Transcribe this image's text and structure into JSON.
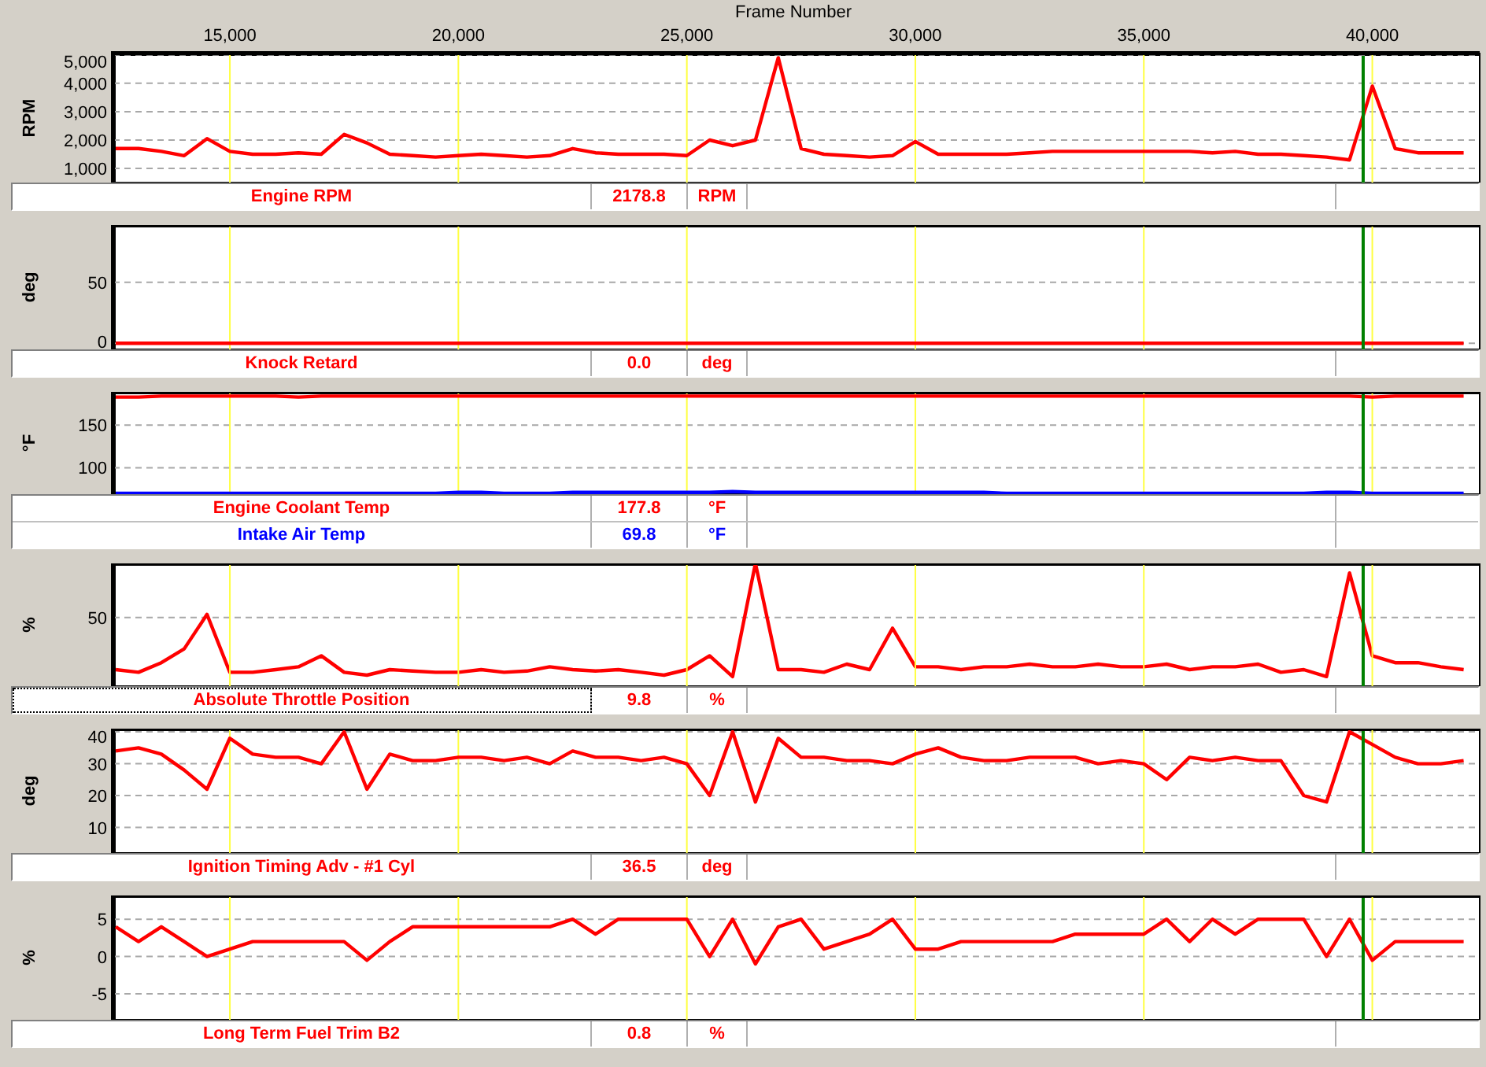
{
  "panels": [
    {
      "chart_data": {
        "type": "line",
        "xlabel": "Frame Number",
        "ylabel": "RPM",
        "xlim": [
          12450,
          42350
        ],
        "ylim": [
          500,
          5050
        ],
        "grid": true,
        "xticks": [
          {
            "value": 15000,
            "label": "15,000"
          },
          {
            "value": 20000,
            "label": "20,000"
          },
          {
            "value": 25000,
            "label": "25,000"
          },
          {
            "value": 30000,
            "label": "30,000"
          },
          {
            "value": 35000,
            "label": "35,000"
          },
          {
            "value": 40000,
            "label": "40,000"
          }
        ],
        "yticks": [
          {
            "value": 1000,
            "label": "1,000"
          },
          {
            "value": 2000,
            "label": "2,000"
          },
          {
            "value": 3000,
            "label": "3,000"
          },
          {
            "value": 4000,
            "label": "4,000"
          },
          {
            "value": 5000,
            "label": "5,000"
          }
        ],
        "x": [
          12500,
          13000,
          13500,
          14000,
          14500,
          15000,
          15500,
          16000,
          16500,
          17000,
          17500,
          18000,
          18500,
          19000,
          19500,
          20000,
          20500,
          21000,
          21500,
          22000,
          22500,
          23000,
          23500,
          24000,
          24500,
          25000,
          25500,
          26000,
          26500,
          27000,
          27500,
          28000,
          28500,
          29000,
          29500,
          30000,
          30500,
          31000,
          31500,
          32000,
          32500,
          33000,
          33500,
          34000,
          34500,
          35000,
          35500,
          36000,
          36500,
          37000,
          37500,
          38000,
          38500,
          39000,
          39500,
          40000,
          40500,
          41000,
          41500,
          42000
        ],
        "series": [
          {
            "name": "Engine RPM",
            "color": "#ff0000",
            "values": [
              1700,
              1700,
              1600,
              1450,
              2050,
              1600,
              1500,
              1500,
              1550,
              1500,
              2200,
              1900,
              1500,
              1450,
              1400,
              1450,
              1500,
              1450,
              1400,
              1450,
              1700,
              1550,
              1500,
              1500,
              1500,
              1450,
              2000,
              1800,
              2000,
              4900,
              1700,
              1500,
              1450,
              1400,
              1450,
              1950,
              1500,
              1500,
              1500,
              1500,
              1550,
              1600,
              1600,
              1600,
              1600,
              1600,
              1600,
              1600,
              1550,
              1600,
              1500,
              1500,
              1450,
              1400,
              1300,
              3900,
              1700,
              1550,
              1550,
              1550
            ]
          }
        ],
        "ref_lines": [
          {
            "axis": "x",
            "value": 39800,
            "color": "#008000"
          }
        ]
      },
      "legend": [
        {
          "value": "2178.8",
          "unit": "RPM",
          "selected": false
        }
      ]
    },
    {
      "chart_data": {
        "type": "line",
        "ylabel": "deg",
        "xlim": [
          12450,
          42350
        ],
        "ylim": [
          -5,
          97
        ],
        "grid": true,
        "yticks": [
          {
            "value": 0,
            "label": "0"
          },
          {
            "value": 50,
            "label": "50"
          }
        ],
        "x": [
          12500,
          13000,
          13500,
          14000,
          14500,
          15000,
          15500,
          16000,
          16500,
          17000,
          17500,
          18000,
          18500,
          19000,
          19500,
          20000,
          20500,
          21000,
          21500,
          22000,
          22500,
          23000,
          23500,
          24000,
          24500,
          25000,
          25500,
          26000,
          26500,
          27000,
          27500,
          28000,
          28500,
          29000,
          29500,
          30000,
          30500,
          31000,
          31500,
          32000,
          32500,
          33000,
          33500,
          34000,
          34500,
          35000,
          35500,
          36000,
          36500,
          37000,
          37500,
          38000,
          38500,
          39000,
          39500,
          40000,
          40500,
          41000,
          41500,
          42000
        ],
        "series": [
          {
            "name": "Knock Retard",
            "color": "#ff0000",
            "values": [
              0,
              0,
              0,
              0,
              0,
              0,
              0,
              0,
              0,
              0,
              0,
              0,
              0,
              0,
              0,
              0,
              0,
              0,
              0,
              0,
              0,
              0,
              0,
              0,
              0,
              0,
              0,
              0,
              0,
              0,
              0,
              0,
              0,
              0,
              0,
              0,
              0,
              0,
              0,
              0,
              0,
              0,
              0,
              0,
              0,
              0,
              0,
              0,
              0,
              0,
              0,
              0,
              0,
              0,
              0,
              0,
              0,
              0,
              0,
              0
            ]
          }
        ],
        "ref_lines": [
          {
            "axis": "x",
            "value": 39800,
            "color": "#008000"
          }
        ]
      },
      "legend": [
        {
          "value": "0.0",
          "unit": "deg",
          "selected": false
        }
      ]
    },
    {
      "chart_data": {
        "type": "line",
        "ylabel": "°F",
        "xlim": [
          12450,
          42350
        ],
        "ylim": [
          69,
          189
        ],
        "grid": true,
        "yticks": [
          {
            "value": 100,
            "label": "100"
          },
          {
            "value": 150,
            "label": "150"
          }
        ],
        "x": [
          12500,
          13000,
          13500,
          14000,
          14500,
          15000,
          15500,
          16000,
          16500,
          17000,
          17500,
          18000,
          18500,
          19000,
          19500,
          20000,
          20500,
          21000,
          21500,
          22000,
          22500,
          23000,
          23500,
          24000,
          24500,
          25000,
          25500,
          26000,
          26500,
          27000,
          27500,
          28000,
          28500,
          29000,
          29500,
          30000,
          30500,
          31000,
          31500,
          32000,
          32500,
          33000,
          33500,
          34000,
          34500,
          35000,
          35500,
          36000,
          36500,
          37000,
          37500,
          38000,
          38500,
          39000,
          39500,
          40000,
          40500,
          41000,
          41500,
          42000
        ],
        "series": [
          {
            "name": "Engine Coolant Temp",
            "color": "#ff0000",
            "values": [
              183,
              183,
              184,
              184,
              184,
              184,
              184,
              184,
              183,
              184,
              184,
              184,
              184,
              184,
              184,
              184,
              184,
              184,
              184,
              184,
              184,
              184,
              184,
              184,
              184,
              184,
              184,
              184,
              184,
              184,
              184,
              184,
              184,
              184,
              184,
              184,
              184,
              184,
              184,
              184,
              184,
              184,
              184,
              184,
              184,
              184,
              184,
              184,
              184,
              184,
              184,
              184,
              184,
              184,
              184,
              183,
              184,
              184,
              184,
              184
            ]
          },
          {
            "name": "Intake Air Temp",
            "color": "#0000ff",
            "values": [
              70,
              70,
              70,
              70,
              70,
              70,
              70,
              70,
              70,
              70,
              70,
              70,
              70,
              70,
              70,
              71,
              71,
              70,
              70,
              70,
              71,
              71,
              71,
              71,
              71,
              71,
              71,
              72,
              71,
              71,
              71,
              71,
              71,
              71,
              71,
              71,
              71,
              71,
              71,
              70,
              70,
              70,
              70,
              70,
              70,
              70,
              70,
              70,
              70,
              70,
              70,
              70,
              70,
              71,
              71,
              70,
              70,
              70,
              70,
              70
            ]
          }
        ],
        "ref_lines": [
          {
            "axis": "x",
            "value": 39800,
            "color": "#008000"
          }
        ]
      },
      "legend": [
        {
          "value": "177.8",
          "unit": "°F",
          "selected": false
        },
        {
          "value": "69.8",
          "unit": "°F",
          "selected": false
        }
      ]
    },
    {
      "plot": {
        "ylabel": "%",
        "tick_labels": [
          "50"
        ]
      },
      "legend": [
        {
          "name": "Absolute Throttle Position",
          "color": "#ff0000",
          "value": "9.8",
          "unit": "%",
          "selected": true
        }
      ]
    },
    {
      "chart_data": {
        "type": "line",
        "ylabel": "deg",
        "xlim": [
          12450,
          42350
        ],
        "ylim": [
          2,
          41
        ],
        "grid": true,
        "yticks": [
          {
            "value": 10,
            "label": "10"
          },
          {
            "value": 20,
            "label": "20"
          },
          {
            "value": 30,
            "label": "30"
          },
          {
            "value": 40,
            "label": "40"
          }
        ],
        "x": [
          12500,
          13000,
          13500,
          14000,
          14500,
          15000,
          15500,
          16000,
          16500,
          17000,
          17500,
          18000,
          18500,
          19000,
          19500,
          20000,
          20500,
          21000,
          21500,
          22000,
          22500,
          23000,
          23500,
          24000,
          24500,
          25000,
          25500,
          26000,
          26500,
          27000,
          27500,
          28000,
          28500,
          29000,
          29500,
          30000,
          30500,
          31000,
          31500,
          32000,
          32500,
          33000,
          33500,
          34000,
          34500,
          35000,
          35500,
          36000,
          36500,
          37000,
          37500,
          38000,
          38500,
          39000,
          39500,
          40000,
          40500,
          41000,
          41500,
          42000
        ],
        "series": [
          {
            "name": "Ignition Timing Adv - #1 Cyl",
            "color": "#ff0000",
            "values": [
              34,
              35,
              33,
              28,
              22,
              38,
              33,
              32,
              32,
              30,
              40,
              22,
              33,
              31,
              31,
              32,
              32,
              31,
              32,
              30,
              34,
              32,
              32,
              31,
              32,
              30,
              20,
              40,
              18,
              38,
              32,
              32,
              31,
              31,
              30,
              33,
              35,
              32,
              31,
              31,
              32,
              32,
              32,
              30,
              31,
              30,
              25,
              32,
              31,
              32,
              31,
              31,
              20,
              18,
              40,
              36,
              32,
              30,
              30,
              31
            ]
          }
        ],
        "ref_lines": [
          {
            "axis": "x",
            "value": 39800,
            "color": "#008000"
          }
        ]
      },
      "legend": [
        {
          "value": "36.5",
          "unit": "deg",
          "selected": false
        }
      ]
    },
    {
      "chart_data": {
        "type": "line",
        "ylabel": "%",
        "xlim": [
          12450,
          42350
        ],
        "ylim": [
          -8.5,
          8.2
        ],
        "grid": true,
        "yticks": [
          {
            "value": -5,
            "label": "-5"
          },
          {
            "value": 0,
            "label": "0"
          },
          {
            "value": 5,
            "label": "5"
          }
        ],
        "x": [
          12500,
          13000,
          13500,
          14000,
          14500,
          15000,
          15500,
          16000,
          16500,
          17000,
          17500,
          18000,
          18500,
          19000,
          19500,
          20000,
          20500,
          21000,
          21500,
          22000,
          22500,
          23000,
          23500,
          24000,
          24500,
          25000,
          25500,
          26000,
          26500,
          27000,
          27500,
          28000,
          28500,
          29000,
          29500,
          30000,
          30500,
          31000,
          31500,
          32000,
          32500,
          33000,
          33500,
          34000,
          34500,
          35000,
          35500,
          36000,
          36500,
          37000,
          37500,
          38000,
          38500,
          39000,
          39500,
          40000,
          40500,
          41000,
          41500,
          42000
        ],
        "series": [
          {
            "name": "Long Term Fuel Trim B2",
            "color": "#ff0000",
            "values": [
              4,
              2,
              4,
              2,
              0,
              1,
              2,
              2,
              2,
              2,
              2,
              -0.5,
              2,
              4,
              4,
              4,
              4,
              4,
              4,
              4,
              5,
              3,
              5,
              5,
              5,
              5,
              0,
              5,
              -1,
              4,
              5,
              1,
              2,
              3,
              5,
              1,
              1,
              2,
              2,
              2,
              2,
              2,
              3,
              3,
              3,
              3,
              5,
              2,
              5,
              3,
              5,
              5,
              5,
              0,
              5,
              -0.5,
              2,
              2,
              2,
              2
            ]
          }
        ],
        "ref_lines": [
          {
            "axis": "x",
            "value": 39800,
            "color": "#008000"
          }
        ]
      },
      "legend": [
        {
          "value": "0.8",
          "unit": "%",
          "selected": false
        }
      ]
    }
  ]
}
